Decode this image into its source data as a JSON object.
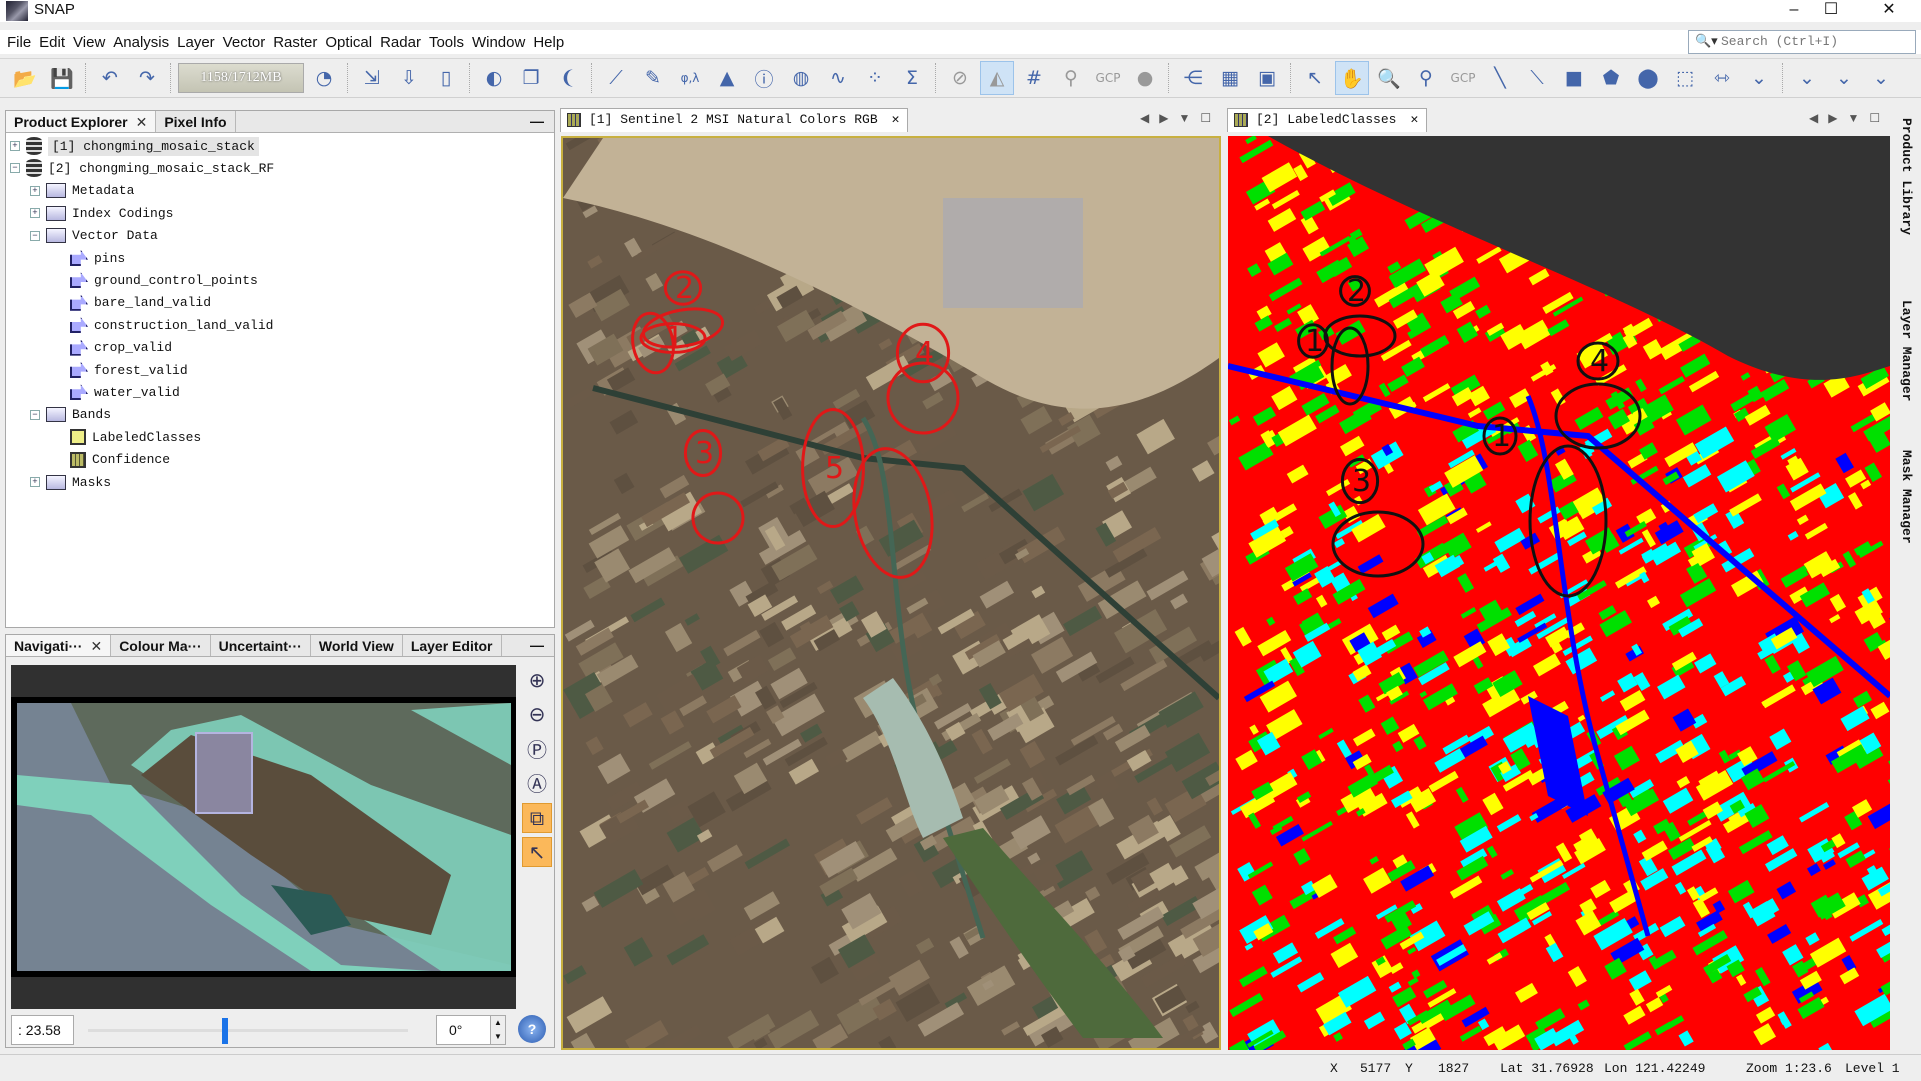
{
  "window": {
    "title": "SNAP",
    "controls": [
      "–",
      "☐",
      "✕"
    ]
  },
  "menu": [
    "File",
    "Edit",
    "View",
    "Analysis",
    "Layer",
    "Vector",
    "Raster",
    "Optical",
    "Radar",
    "Tools",
    "Window",
    "Help"
  ],
  "search": {
    "placeholder": "Search (Ctrl+I)",
    "icon": "search-icon"
  },
  "toolbar": {
    "memory": "1158/1712MB",
    "left_icons": [
      "open-product",
      "save-product",
      "|",
      "undo",
      "redo",
      "|"
    ],
    "mid_icons": [
      "gc-clock",
      "|",
      "import-vector",
      "export-down",
      "export-file",
      "|",
      "rgb-image",
      "band-maths-window",
      "wind-glyph",
      "|",
      "spectrum-view",
      "edit",
      "phi-lambda",
      "histogram",
      "information",
      "statistics-image",
      "profile-plot",
      "scatter-plot",
      "sigma-statistics",
      "|",
      "overlay-none",
      "overlay-world-map",
      "graticule",
      "pin-overlay",
      "gcp-overlay",
      "mask-overlay",
      "|",
      "graph-builder",
      "batch-processing",
      "spectral-unmixing",
      "|",
      "select-tool",
      "pan-tool",
      "zoom-tool",
      "pin-placing",
      "gcp-placing",
      "line-drawing",
      "polyline-drawing",
      "rectangle-drawing",
      "polygon-drawing",
      "ellipse-drawing",
      "magic-wand",
      "range-finder",
      "more",
      "|",
      "more",
      "more",
      "more"
    ],
    "glyphs": {
      "open-product": "📂",
      "save-product": "💾",
      "undo": "↶",
      "redo": "↷",
      "gc-clock": "◔",
      "import-vector": "⇲",
      "export-down": "⇩",
      "export-file": "▯",
      "rgb-image": "◐",
      "band-maths-window": "❐",
      "wind-glyph": "❨",
      "spectrum-view": "⟋",
      "edit": "✎",
      "phi-lambda": "φ,λ",
      "histogram": "▲",
      "information": "ⓘ",
      "statistics-image": "◍",
      "profile-plot": "∿",
      "scatter-plot": "⁘",
      "sigma-statistics": "Σ",
      "overlay-none": "⊘",
      "overlay-world-map": "◭",
      "graticule": "#",
      "pin-overlay": "⚲",
      "gcp-overlay": "GCP",
      "mask-overlay": "●",
      "graph-builder": "⋲",
      "batch-processing": "▦",
      "spectral-unmixing": "▣",
      "select-tool": "↖",
      "pan-tool": "✋",
      "zoom-tool": "🔍",
      "pin-placing": "⚲",
      "gcp-placing": "GCP",
      "line-drawing": "╲",
      "polyline-drawing": "⟍",
      "rectangle-drawing": "■",
      "polygon-drawing": "⬟",
      "ellipse-drawing": "⬤",
      "magic-wand": "⬚",
      "range-finder": "⇿",
      "more": "⌄"
    },
    "active": [
      "overlay-world-map",
      "pan-tool"
    ]
  },
  "product_explorer": {
    "tabs": [
      {
        "label": "Product Explorer",
        "closable": true
      },
      {
        "label": "Pixel Info"
      }
    ],
    "tree": [
      {
        "level": 0,
        "expander": "+",
        "icon": "product",
        "label": "[1] chongming_mosaic_stack",
        "selected": true
      },
      {
        "level": 0,
        "expander": "-",
        "icon": "product",
        "label": "[2] chongming_mosaic_stack_RF"
      },
      {
        "level": 1,
        "expander": "+",
        "icon": "folder",
        "label": "Metadata"
      },
      {
        "level": 1,
        "expander": "+",
        "icon": "folder",
        "label": "Index Codings"
      },
      {
        "level": 1,
        "expander": "-",
        "icon": "folder",
        "label": "Vector Data"
      },
      {
        "level": 2,
        "icon": "vector",
        "label": "pins"
      },
      {
        "level": 2,
        "icon": "vector",
        "label": "ground_control_points"
      },
      {
        "level": 2,
        "icon": "vector",
        "label": "bare_land_valid"
      },
      {
        "level": 2,
        "icon": "vector",
        "label": "construction_land_valid"
      },
      {
        "level": 2,
        "icon": "vector",
        "label": "crop_valid"
      },
      {
        "level": 2,
        "icon": "vector",
        "label": "forest_valid"
      },
      {
        "level": 2,
        "icon": "vector",
        "label": "water_valid"
      },
      {
        "level": 1,
        "expander": "-",
        "icon": "folder",
        "label": "Bands"
      },
      {
        "level": 2,
        "icon": "band-index",
        "label": "LabeledClasses"
      },
      {
        "level": 2,
        "icon": "band",
        "label": "Confidence"
      },
      {
        "level": 1,
        "expander": "+",
        "icon": "folder",
        "label": "Masks"
      }
    ]
  },
  "navigation": {
    "tabs": [
      {
        "label": "Navigati···",
        "closable": true
      },
      {
        "label": "Colour Ma···"
      },
      {
        "label": "Uncertaint···"
      },
      {
        "label": "World View"
      },
      {
        "label": "Layer Editor"
      }
    ],
    "zoom_value": ":  23.58",
    "slider_fraction": 0.42,
    "rotation": "0°",
    "buttons": [
      "zoom-in",
      "zoom-out",
      "zoom-pixel",
      "zoom-all",
      "sync-views",
      "sync-cursor",
      "help"
    ]
  },
  "views": [
    {
      "tab": "[1] Sentinel 2 MSI Natural Colors RGB",
      "annotations": [
        {
          "t": "2",
          "c": "#e01818"
        },
        {
          "t": "1",
          "c": "#e01818"
        },
        {
          "t": "4",
          "c": "#e01818"
        },
        {
          "t": "3",
          "c": "#e01818"
        },
        {
          "t": "5",
          "c": "#e01818"
        }
      ]
    },
    {
      "tab": "[2] LabeledClasses",
      "annotations": [
        {
          "t": "2",
          "c": "#111"
        },
        {
          "t": "1",
          "c": "#111"
        },
        {
          "t": "4",
          "c": "#111"
        },
        {
          "t": "1",
          "c": "#111"
        },
        {
          "t": "3",
          "c": "#111"
        }
      ],
      "class_colors": [
        "#ff0000",
        "#ffff00",
        "#00e000",
        "#00ffff",
        "#0000ff",
        "#333333"
      ]
    }
  ],
  "right_sidebar": [
    "Product Library",
    "Layer Manager",
    "Mask Manager"
  ],
  "status": {
    "x_label": "X",
    "x": "5177",
    "y_label": "Y",
    "y": "1827",
    "lat": "Lat 31.76928",
    "lon": "Lon 121.42249",
    "zoom": "Zoom 1:23.6",
    "level": "Level 1"
  }
}
